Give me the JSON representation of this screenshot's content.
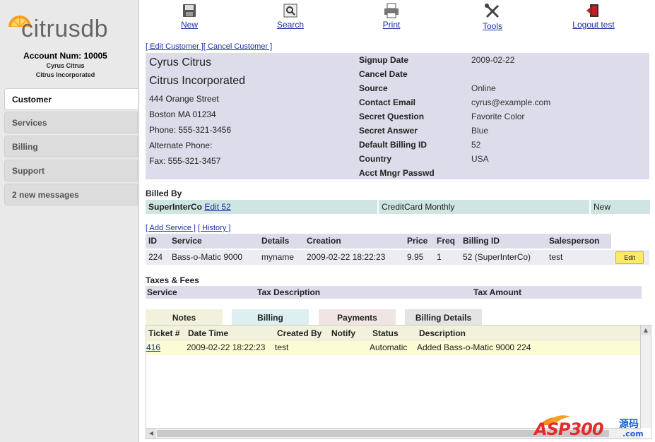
{
  "sidebar": {
    "logo_text": "citrusdb",
    "account_num_label": "Account Num:",
    "account_num": "10005",
    "customer_name": "Cyrus Citrus",
    "company": "Citrus Incorporated",
    "tabs": [
      "Customer",
      "Services",
      "Billing",
      "Support",
      "2 new messages"
    ]
  },
  "toolbar": {
    "new": "New",
    "search": "Search",
    "print": "Print",
    "tools": "Tools",
    "logout": "Logout test"
  },
  "customer_links": {
    "edit": "[ Edit Customer ]",
    "cancel": "[ Cancel Customer ]"
  },
  "customer": {
    "name": "Cyrus Citrus",
    "company": "Citrus Incorporated",
    "street": "444 Orange Street",
    "city": "Boston MA 01234",
    "phone": "Phone: 555-321-3456",
    "alt_phone": "Alternate Phone:",
    "fax": "Fax: 555-321-3457"
  },
  "details": [
    {
      "k": "Signup Date",
      "v": "2009-02-22"
    },
    {
      "k": "Cancel Date",
      "v": ""
    },
    {
      "k": "Source",
      "v": "Online"
    },
    {
      "k": "Contact Email",
      "v": "cyrus@example.com"
    },
    {
      "k": "Secret Question",
      "v": "Favorite Color"
    },
    {
      "k": "Secret Answer",
      "v": "Blue"
    },
    {
      "k": "Default Billing ID",
      "v": "52"
    },
    {
      "k": "Country",
      "v": "USA"
    },
    {
      "k": "Acct Mngr Passwd",
      "v": ""
    }
  ],
  "billed_by": {
    "title": "Billed By",
    "company": "SuperInterCo",
    "edit_link": "Edit 52",
    "plan": "CreditCard Monthly",
    "status": "New"
  },
  "service_links": {
    "add": "[ Add Service ]",
    "history": "[ History ]"
  },
  "services": {
    "headers": [
      "ID",
      "Service",
      "Details",
      "Creation",
      "Price",
      "Freq",
      "Billing ID",
      "Salesperson"
    ],
    "rows": [
      [
        "224",
        "Bass-o-Matic 9000",
        "myname",
        "2009-02-22 18:22:23",
        "9.95",
        "1",
        "52 (SuperInterCo)",
        "test"
      ]
    ],
    "edit_label": "Edit"
  },
  "taxes": {
    "title": "Taxes & Fees",
    "headers": [
      "Service",
      "Tax Description",
      "Tax Amount"
    ]
  },
  "bottom_tabs": [
    "Notes",
    "Billing",
    "Payments",
    "Billing Details"
  ],
  "notes": {
    "headers": [
      "Ticket #",
      "Date Time",
      "Created By",
      "Notify",
      "Status",
      "Description"
    ],
    "rows": [
      [
        "416",
        "2009-02-22 18:22:23",
        "test",
        "",
        "Automatic",
        "Added Bass-o-Matic 9000 224"
      ]
    ]
  },
  "watermark": {
    "text": "ASP300",
    "sub": "源码",
    "domain": ".com"
  },
  "colors": {
    "accent_orange": "#f5a020",
    "link_blue": "#1a2fa0",
    "panel_lavender": "#dcdcea",
    "billed_teal": "#cfe5e2"
  }
}
